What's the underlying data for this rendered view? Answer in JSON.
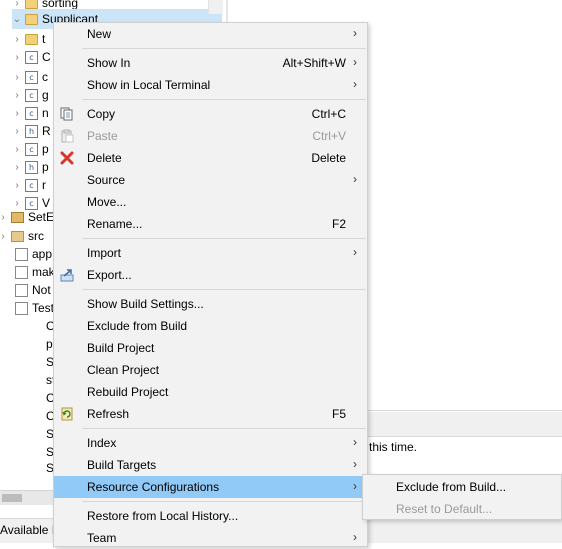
{
  "tree": {
    "rows": [
      {
        "label": "sorting",
        "icon": "folder-icon",
        "arrow": "›"
      },
      {
        "label": "Supplicant",
        "icon": "folder-icon",
        "arrow": "⌄"
      },
      {
        "label": "t",
        "icon": "folder-icon",
        "arrow": "›"
      },
      {
        "label": "C",
        "icon": "c-file-icon",
        "arrow": "›"
      },
      {
        "label": "c",
        "icon": "c-file-icon",
        "arrow": "›"
      },
      {
        "label": "g",
        "icon": "c-file-icon",
        "arrow": "›"
      },
      {
        "label": "n",
        "icon": "c-file-icon",
        "arrow": "›"
      },
      {
        "label": "R",
        "icon": "h-file-icon",
        "arrow": "›"
      },
      {
        "label": "p",
        "icon": "c-file-icon",
        "arrow": "›"
      },
      {
        "label": "p",
        "icon": "h-file-icon",
        "arrow": "›"
      },
      {
        "label": "r",
        "icon": "c-file-icon",
        "arrow": "›"
      },
      {
        "label": "V",
        "icon": "c-file-icon",
        "arrow": "›"
      },
      {
        "label": "SetE",
        "icon": "project-icon",
        "arrow": "›"
      },
      {
        "label": "src",
        "icon": "source-folder-icon",
        "arrow": "›"
      },
      {
        "label": "app",
        "icon": "file-icon",
        "arrow": ""
      },
      {
        "label": "mak",
        "icon": "makefile-icon",
        "arrow": ""
      },
      {
        "label": "Not",
        "icon": "file-icon",
        "arrow": ""
      },
      {
        "label": "Test",
        "icon": "file-icon",
        "arrow": ""
      }
    ],
    "partial_rows": [
      "O",
      "p",
      "SE",
      "st",
      "C",
      "O",
      "S",
      "S",
      "S",
      "S"
    ]
  },
  "bottom": {
    "message": "this time.",
    "status_left": "Available F"
  },
  "menu": {
    "items": [
      {
        "label": "New",
        "shortcut": "",
        "submenu": true,
        "icon": "",
        "disabled": false
      },
      {
        "label": "Show In",
        "shortcut": "Alt+Shift+W",
        "submenu": true,
        "icon": "",
        "disabled": false
      },
      {
        "label": "Show in Local Terminal",
        "shortcut": "",
        "submenu": true,
        "icon": "",
        "disabled": false
      },
      {
        "label": "Copy",
        "shortcut": "Ctrl+C",
        "submenu": false,
        "icon": "copy-icon",
        "disabled": false
      },
      {
        "label": "Paste",
        "shortcut": "Ctrl+V",
        "submenu": false,
        "icon": "paste-icon",
        "disabled": true
      },
      {
        "label": "Delete",
        "shortcut": "Delete",
        "submenu": false,
        "icon": "delete-icon",
        "disabled": false
      },
      {
        "label": "Source",
        "shortcut": "",
        "submenu": true,
        "icon": "",
        "disabled": false
      },
      {
        "label": "Move...",
        "shortcut": "",
        "submenu": false,
        "icon": "",
        "disabled": false
      },
      {
        "label": "Rename...",
        "shortcut": "F2",
        "submenu": false,
        "icon": "",
        "disabled": false
      },
      {
        "label": "Import",
        "shortcut": "",
        "submenu": true,
        "icon": "",
        "disabled": false
      },
      {
        "label": "Export...",
        "shortcut": "",
        "submenu": false,
        "icon": "export-icon",
        "disabled": false
      },
      {
        "label": "Show Build Settings...",
        "shortcut": "",
        "submenu": false,
        "icon": "",
        "disabled": false
      },
      {
        "label": "Exclude from Build",
        "shortcut": "",
        "submenu": false,
        "icon": "",
        "disabled": false
      },
      {
        "label": "Build Project",
        "shortcut": "",
        "submenu": false,
        "icon": "",
        "disabled": false
      },
      {
        "label": "Clean Project",
        "shortcut": "",
        "submenu": false,
        "icon": "",
        "disabled": false
      },
      {
        "label": "Rebuild Project",
        "shortcut": "",
        "submenu": false,
        "icon": "",
        "disabled": false
      },
      {
        "label": "Refresh",
        "shortcut": "F5",
        "submenu": false,
        "icon": "refresh-icon",
        "disabled": false
      },
      {
        "label": "Index",
        "shortcut": "",
        "submenu": true,
        "icon": "",
        "disabled": false
      },
      {
        "label": "Build Targets",
        "shortcut": "",
        "submenu": true,
        "icon": "",
        "disabled": false
      },
      {
        "label": "Resource Configurations",
        "shortcut": "",
        "submenu": true,
        "icon": "",
        "disabled": false,
        "highlighted": true
      },
      {
        "label": "Restore from Local History...",
        "shortcut": "",
        "submenu": false,
        "icon": "",
        "disabled": false
      },
      {
        "label": "Team",
        "shortcut": "",
        "submenu": true,
        "icon": "",
        "disabled": false
      }
    ],
    "submenu_arrow": "›"
  },
  "submenu": {
    "items": [
      {
        "label": "Exclude from Build...",
        "disabled": false
      },
      {
        "label": "Reset to Default...",
        "disabled": true
      }
    ]
  },
  "colors": {
    "highlight": "#91c9f7",
    "menu_bg": "#f2f2f2",
    "delete_icon": "#d9342b",
    "disabled_text": "#9a9a9a"
  }
}
